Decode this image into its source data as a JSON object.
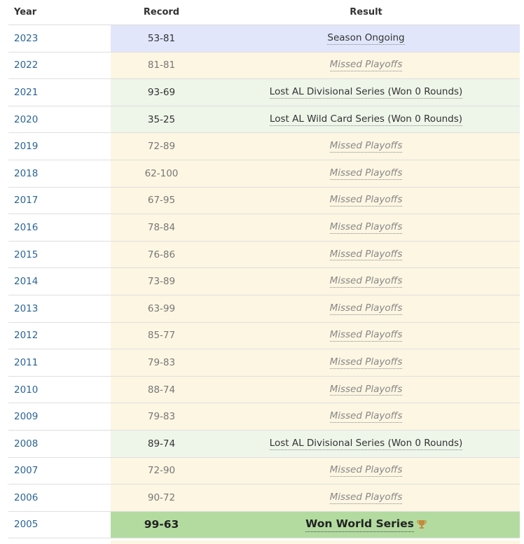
{
  "headers": {
    "year": "Year",
    "record": "Record",
    "result": "Result"
  },
  "rows": [
    {
      "year": "2023",
      "record": "53-81",
      "result": "Season Ongoing",
      "type": "ongoing"
    },
    {
      "year": "2022",
      "record": "81-81",
      "result": "Missed Playoffs",
      "type": "missed"
    },
    {
      "year": "2021",
      "record": "93-69",
      "result": "Lost AL Divisional Series (Won 0 Rounds)",
      "type": "lost"
    },
    {
      "year": "2020",
      "record": "35-25",
      "result": "Lost AL Wild Card Series (Won 0 Rounds)",
      "type": "lost"
    },
    {
      "year": "2019",
      "record": "72-89",
      "result": "Missed Playoffs",
      "type": "missed"
    },
    {
      "year": "2018",
      "record": "62-100",
      "result": "Missed Playoffs",
      "type": "missed"
    },
    {
      "year": "2017",
      "record": "67-95",
      "result": "Missed Playoffs",
      "type": "missed"
    },
    {
      "year": "2016",
      "record": "78-84",
      "result": "Missed Playoffs",
      "type": "missed"
    },
    {
      "year": "2015",
      "record": "76-86",
      "result": "Missed Playoffs",
      "type": "missed"
    },
    {
      "year": "2014",
      "record": "73-89",
      "result": "Missed Playoffs",
      "type": "missed"
    },
    {
      "year": "2013",
      "record": "63-99",
      "result": "Missed Playoffs",
      "type": "missed"
    },
    {
      "year": "2012",
      "record": "85-77",
      "result": "Missed Playoffs",
      "type": "missed"
    },
    {
      "year": "2011",
      "record": "79-83",
      "result": "Missed Playoffs",
      "type": "missed"
    },
    {
      "year": "2010",
      "record": "88-74",
      "result": "Missed Playoffs",
      "type": "missed"
    },
    {
      "year": "2009",
      "record": "79-83",
      "result": "Missed Playoffs",
      "type": "missed"
    },
    {
      "year": "2008",
      "record": "89-74",
      "result": "Lost AL Divisional Series (Won 0 Rounds)",
      "type": "lost"
    },
    {
      "year": "2007",
      "record": "72-90",
      "result": "Missed Playoffs",
      "type": "missed"
    },
    {
      "year": "2006",
      "record": "90-72",
      "result": "Missed Playoffs",
      "type": "missed"
    },
    {
      "year": "2005",
      "record": "99-63",
      "result": "Won World Series",
      "type": "won",
      "icon": "trophy-icon"
    }
  ],
  "colors": {
    "ongoing": "#e1e6fa",
    "missed": "#fcf6e2",
    "lost": "#eef5e9",
    "won": "#b3dba0",
    "year_link": "#2a6496"
  }
}
